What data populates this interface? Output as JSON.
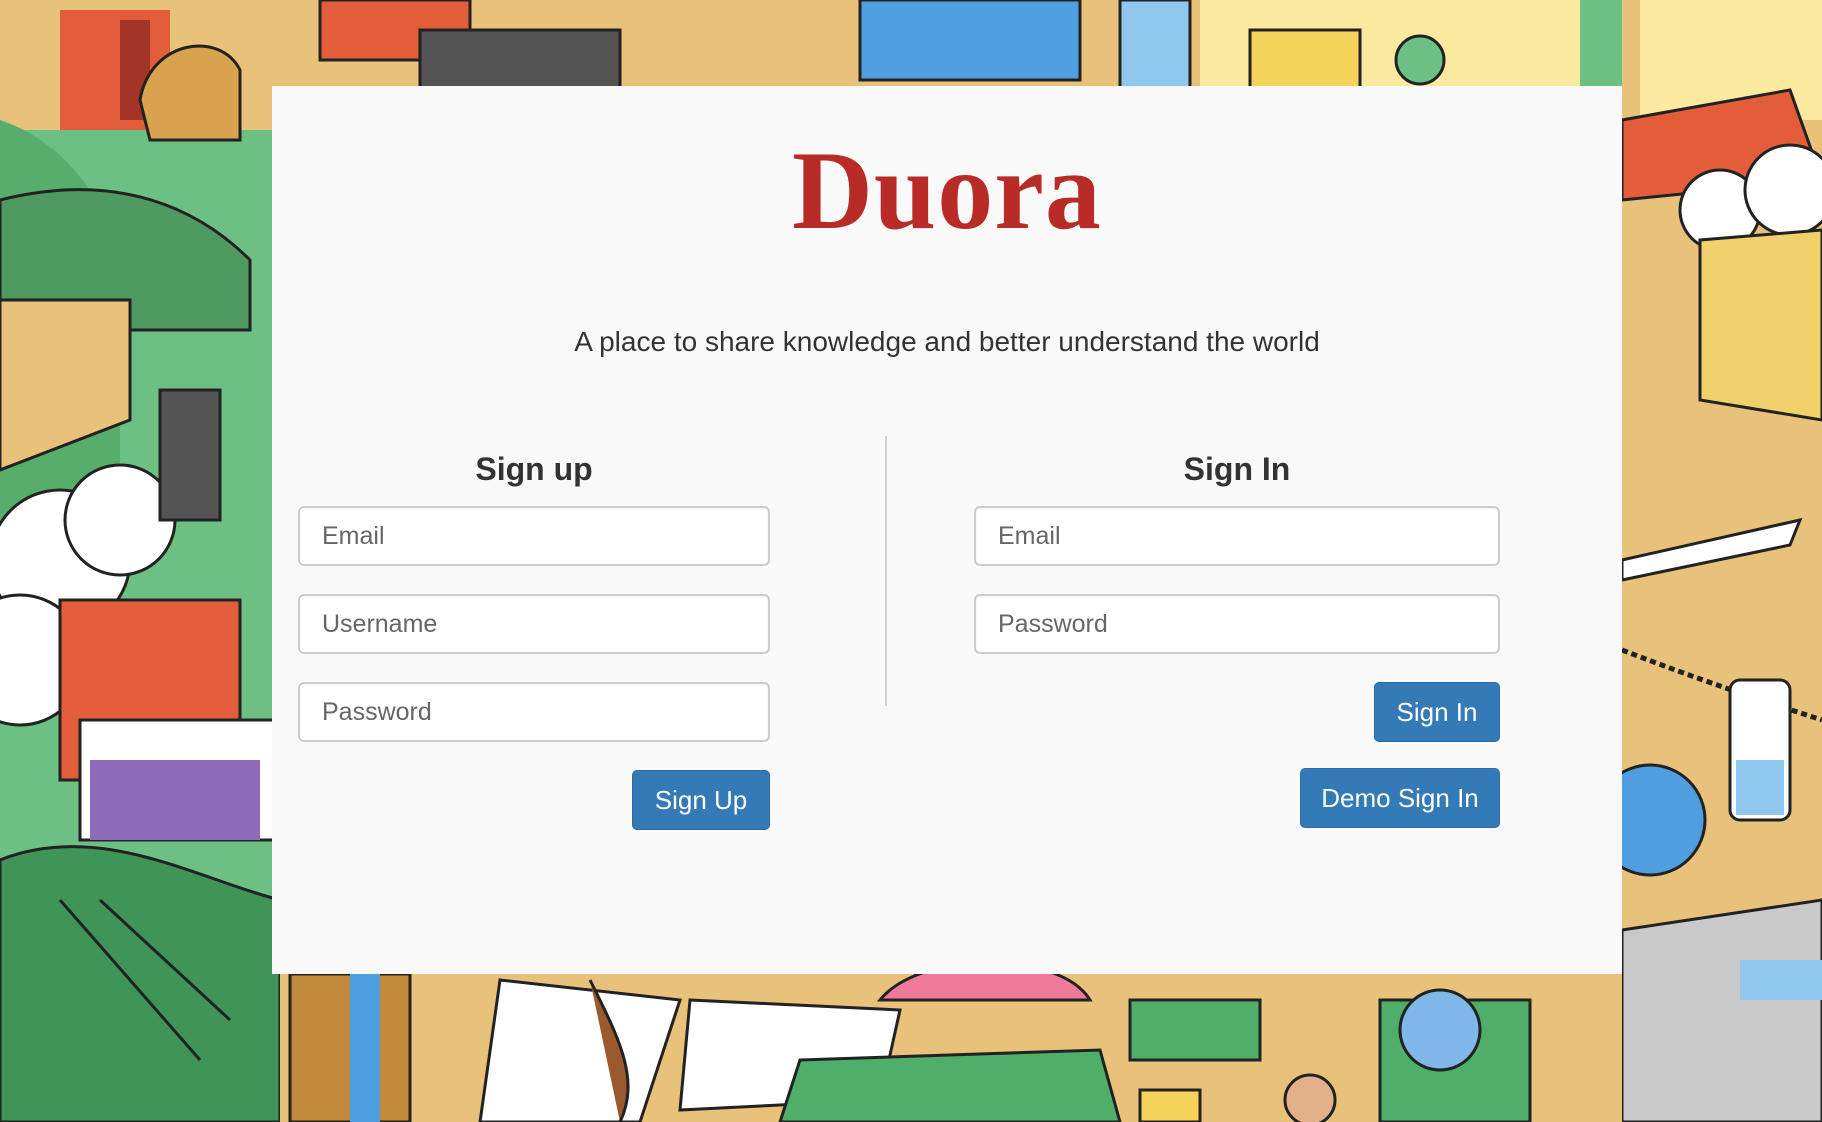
{
  "brand": {
    "name": "Duora",
    "tagline": "A place to share knowledge and better understand the world",
    "colors": {
      "logo": "#b92b27",
      "button": "#337ab7",
      "card": "#f9f9f9"
    }
  },
  "signup": {
    "title": "Sign up",
    "email_placeholder": "Email",
    "username_placeholder": "Username",
    "password_placeholder": "Password",
    "submit_label": "Sign Up"
  },
  "signin": {
    "title": "Sign In",
    "email_placeholder": "Email",
    "password_placeholder": "Password",
    "submit_label": "Sign In",
    "demo_label": "Demo Sign In"
  }
}
